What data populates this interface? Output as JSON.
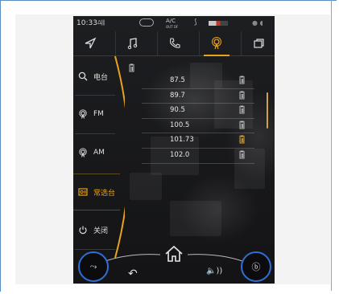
{
  "status_bar": {
    "time": "10:33",
    "signal": "Δ∥∥",
    "ac_label": "A/C",
    "ac_sub": "OUT OF"
  },
  "tabs": [
    {
      "name": "navigation",
      "icon": "navigation-arrow-icon",
      "active": false
    },
    {
      "name": "music",
      "icon": "music-note-icon",
      "active": false
    },
    {
      "name": "phone",
      "icon": "phone-icon",
      "active": false
    },
    {
      "name": "radio",
      "icon": "radio-icon",
      "active": true
    },
    {
      "name": "apps",
      "icon": "apps-icon",
      "active": false
    }
  ],
  "sidebar": {
    "items": [
      {
        "label": "电台",
        "icon": "search-icon"
      },
      {
        "label": "FM",
        "icon": "radio-icon"
      },
      {
        "label": "AM",
        "icon": "radio-icon"
      },
      {
        "label": "常选台",
        "icon": "favorites-icon",
        "active": true
      },
      {
        "label": "关闭",
        "icon": "power-icon"
      }
    ]
  },
  "stations": [
    {
      "freq": "87.5",
      "highlight": false
    },
    {
      "freq": "89.7",
      "highlight": false
    },
    {
      "freq": "90.5",
      "highlight": false
    },
    {
      "freq": "100.5",
      "highlight": false
    },
    {
      "freq": "101.73",
      "highlight": true
    },
    {
      "freq": "102.0",
      "highlight": false
    }
  ],
  "bottom_bar": {
    "back_glyph": "↶",
    "volume_glyph": "🔈))",
    "left_knob_glyph": "⤳",
    "right_knob_glyph": "ⓑ"
  },
  "colors": {
    "accent": "#e8a21c",
    "knob_ring": "#2e6fd6",
    "frame": "#5a8fc4"
  }
}
